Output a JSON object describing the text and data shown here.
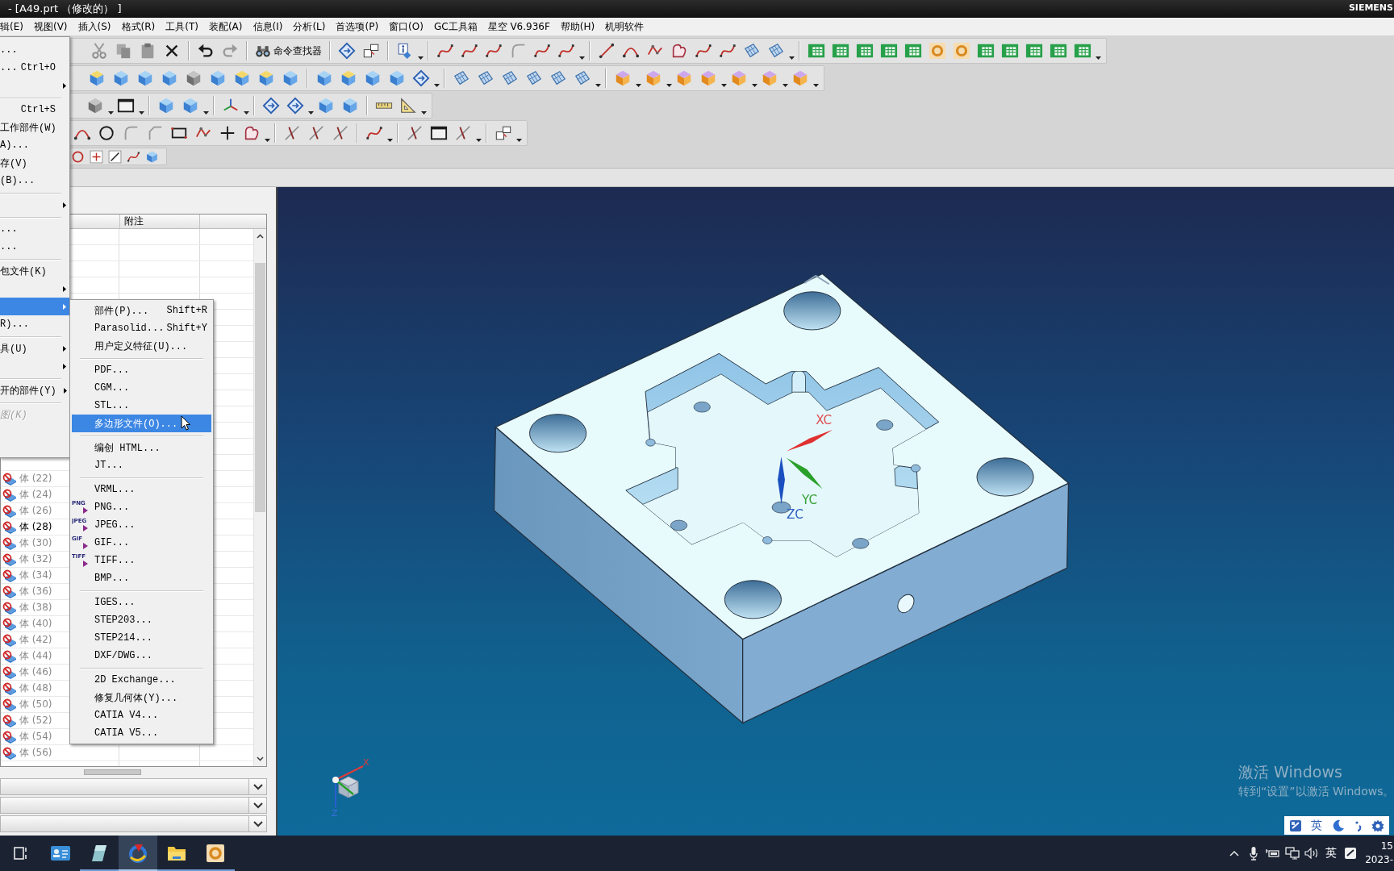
{
  "window": {
    "title": "- [A49.prt （修改的） ]",
    "brand": "SIEMENS"
  },
  "menu_bar": [
    "辑(E)",
    "视图(V)",
    "插入(S)",
    "格式(R)",
    "工具(T)",
    "装配(A)",
    "信息(I)",
    "分析(L)",
    "首选项(P)",
    "窗口(O)",
    "GC工具箱",
    "星空 V6.936F",
    "帮助(H)",
    "机明软件"
  ],
  "toolbar": {
    "command_finder": "命令查找器"
  },
  "file_menu": [
    {
      "kind": "item",
      "label": "...",
      "submenu": false,
      "selected": false,
      "disabled": false
    },
    {
      "kind": "item",
      "label": "...",
      "shortcut": "Ctrl+O",
      "submenu": false,
      "selected": false,
      "disabled": false
    },
    {
      "kind": "item",
      "submenu": true,
      "selected": false,
      "disabled": false
    },
    {
      "kind": "separator"
    },
    {
      "kind": "item",
      "shortcut": "Ctrl+S",
      "submenu": false,
      "selected": false,
      "disabled": false
    },
    {
      "kind": "item",
      "label": "工作部件(W)",
      "submenu": false,
      "selected": false,
      "disabled": false
    },
    {
      "kind": "item",
      "label": "A)...",
      "submenu": false,
      "selected": false,
      "disabled": false
    },
    {
      "kind": "item",
      "label": "存(V)",
      "submenu": false,
      "selected": false,
      "disabled": false
    },
    {
      "kind": "item",
      "label": "(B)...",
      "submenu": false,
      "selected": false,
      "disabled": false
    },
    {
      "kind": "separator"
    },
    {
      "kind": "item",
      "submenu": true,
      "selected": false,
      "disabled": false
    },
    {
      "kind": "separator"
    },
    {
      "kind": "item",
      "label": "...",
      "submenu": false,
      "selected": false,
      "disabled": false
    },
    {
      "kind": "item",
      "label": "...",
      "submenu": false,
      "selected": false,
      "disabled": false
    },
    {
      "kind": "separator"
    },
    {
      "kind": "item",
      "label": "包文件(K)",
      "submenu": false,
      "selected": false,
      "disabled": false
    },
    {
      "kind": "item",
      "submenu": true,
      "selected": false,
      "disabled": false
    },
    {
      "kind": "item",
      "submenu": true,
      "selected": true,
      "disabled": false
    },
    {
      "kind": "item",
      "label": "R)...",
      "submenu": false,
      "selected": false,
      "disabled": false
    },
    {
      "kind": "separator"
    },
    {
      "kind": "item",
      "label": "具(U)",
      "submenu": true,
      "selected": false,
      "disabled": false
    },
    {
      "kind": "item",
      "submenu": true,
      "selected": false,
      "disabled": false
    },
    {
      "kind": "separator"
    },
    {
      "kind": "item",
      "label": "开的部件(Y)",
      "submenu": true,
      "selected": false,
      "disabled": false
    },
    {
      "kind": "separator"
    },
    {
      "kind": "item",
      "label": "图(K)",
      "submenu": false,
      "selected": false,
      "disabled": true
    }
  ],
  "export_menu": [
    {
      "kind": "item",
      "label": "部件(P)...",
      "shortcut": "Shift+R",
      "selected": false
    },
    {
      "kind": "item",
      "label": "Parasolid...",
      "shortcut": "Shift+Y",
      "selected": false
    },
    {
      "kind": "item",
      "label": "用户定义特征(U)...",
      "selected": false
    },
    {
      "kind": "separator"
    },
    {
      "kind": "item",
      "label": "PDF...",
      "selected": false
    },
    {
      "kind": "item",
      "label": "CGM...",
      "selected": false
    },
    {
      "kind": "item",
      "label": "STL...",
      "selected": false
    },
    {
      "kind": "item",
      "label": "多边形文件(O)...",
      "selected": true
    },
    {
      "kind": "separator"
    },
    {
      "kind": "item",
      "label": "编创 HTML...",
      "selected": false
    },
    {
      "kind": "item",
      "label": "JT...",
      "selected": false
    },
    {
      "kind": "separator"
    },
    {
      "kind": "item",
      "label": "VRML...",
      "selected": false
    },
    {
      "kind": "item",
      "label": "PNG...",
      "icon_label": "PNG",
      "selected": false
    },
    {
      "kind": "item",
      "label": "JPEG...",
      "icon_label": "JPEG",
      "selected": false
    },
    {
      "kind": "item",
      "label": "GIF...",
      "icon_label": "GIF",
      "selected": false
    },
    {
      "kind": "item",
      "label": "TIFF...",
      "icon_label": "TIFF",
      "selected": false
    },
    {
      "kind": "item",
      "label": "BMP...",
      "selected": false
    },
    {
      "kind": "separator"
    },
    {
      "kind": "item",
      "label": "IGES...",
      "selected": false
    },
    {
      "kind": "item",
      "label": "STEP203...",
      "selected": false
    },
    {
      "kind": "item",
      "label": "STEP214...",
      "selected": false
    },
    {
      "kind": "item",
      "label": "DXF/DWG...",
      "selected": false
    },
    {
      "kind": "separator"
    },
    {
      "kind": "item",
      "label": "2D Exchange...",
      "selected": false
    },
    {
      "kind": "item",
      "label": "修复几何体(Y)...",
      "selected": false
    },
    {
      "kind": "item",
      "label": "CATIA V4...",
      "selected": false
    },
    {
      "kind": "item",
      "label": "CATIA V5...",
      "selected": false
    }
  ],
  "part_navigator": {
    "columns": [
      "附注"
    ],
    "rows": [
      {
        "label": "体 (22)",
        "greyed": true
      },
      {
        "label": "体 (24)",
        "greyed": true
      },
      {
        "label": "体 (26)",
        "greyed": true
      },
      {
        "label": "体 (28)",
        "greyed": false
      },
      {
        "label": "体 (30)",
        "greyed": true
      },
      {
        "label": "体 (32)",
        "greyed": true
      },
      {
        "label": "体 (34)",
        "greyed": true
      },
      {
        "label": "体 (36)",
        "greyed": true
      },
      {
        "label": "体 (38)",
        "greyed": true
      },
      {
        "label": "体 (40)",
        "greyed": true
      },
      {
        "label": "体 (42)",
        "greyed": true
      },
      {
        "label": "体 (44)",
        "greyed": true
      },
      {
        "label": "体 (46)",
        "greyed": true
      },
      {
        "label": "体 (48)",
        "greyed": true
      },
      {
        "label": "体 (50)",
        "greyed": true
      },
      {
        "label": "体 (52)",
        "greyed": true
      },
      {
        "label": "体 (54)",
        "greyed": true
      },
      {
        "label": "体 (56)",
        "greyed": true
      }
    ],
    "sections": [
      {
        "expanded": false
      },
      {
        "expanded": false
      },
      {
        "expanded": false
      }
    ]
  },
  "viewport": {
    "wcs_axes": {
      "x": "XC",
      "y": "YC",
      "z": "ZC"
    },
    "view_triad": {
      "x": "X",
      "z": "Z"
    }
  },
  "activation_notice": {
    "title": "激活 Windows",
    "subtitle": "转到“设置”以激活 Windows。"
  },
  "ime_toolbar": {
    "mode": "英"
  },
  "taskbar": {
    "apps": [
      {
        "selected": false,
        "running": false
      },
      {
        "selected": false,
        "running": true
      },
      {
        "selected": true,
        "running": true
      },
      {
        "selected": false,
        "running": true
      },
      {
        "selected": false,
        "running": true
      }
    ],
    "tray": {
      "ime": "英",
      "time": "15",
      "date": "2023-"
    }
  }
}
